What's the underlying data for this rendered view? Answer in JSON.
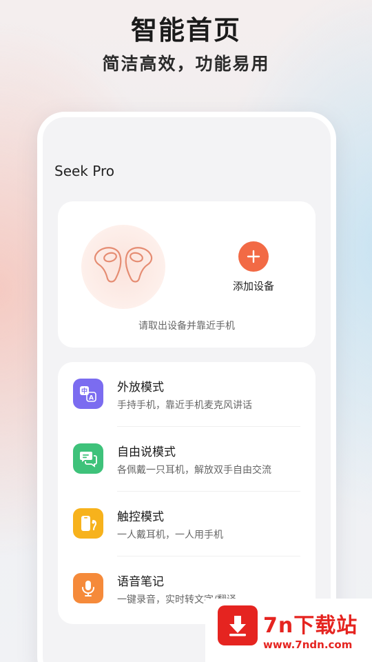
{
  "header": {
    "title": "智能首页",
    "subtitle": "简洁高效，功能易用"
  },
  "app": {
    "device_name": "Seek Pro",
    "add_device_label": "添加设备",
    "hint": "请取出设备并靠近手机",
    "accent_color": "#f26a45"
  },
  "modes": [
    {
      "title": "外放模式",
      "desc": "手持手机，靠近手机麦克风讲话",
      "icon": "translate-icon",
      "color": "#7b6cf0"
    },
    {
      "title": "自由说模式",
      "desc": "各佩戴一只耳机，解放双手自由交流",
      "icon": "chat-bubbles-icon",
      "color": "#3ec27a"
    },
    {
      "title": "触控模式",
      "desc": "一人戴耳机，一人用手机",
      "icon": "phone-earbud-icon",
      "color": "#f7b21c"
    },
    {
      "title": "语音笔记",
      "desc": "一键录音，实时转文字/翻译",
      "icon": "microphone-icon",
      "color": "#f58a3a"
    }
  ],
  "watermark": {
    "name": "7n下载站",
    "url": "www.7ndn.com"
  }
}
